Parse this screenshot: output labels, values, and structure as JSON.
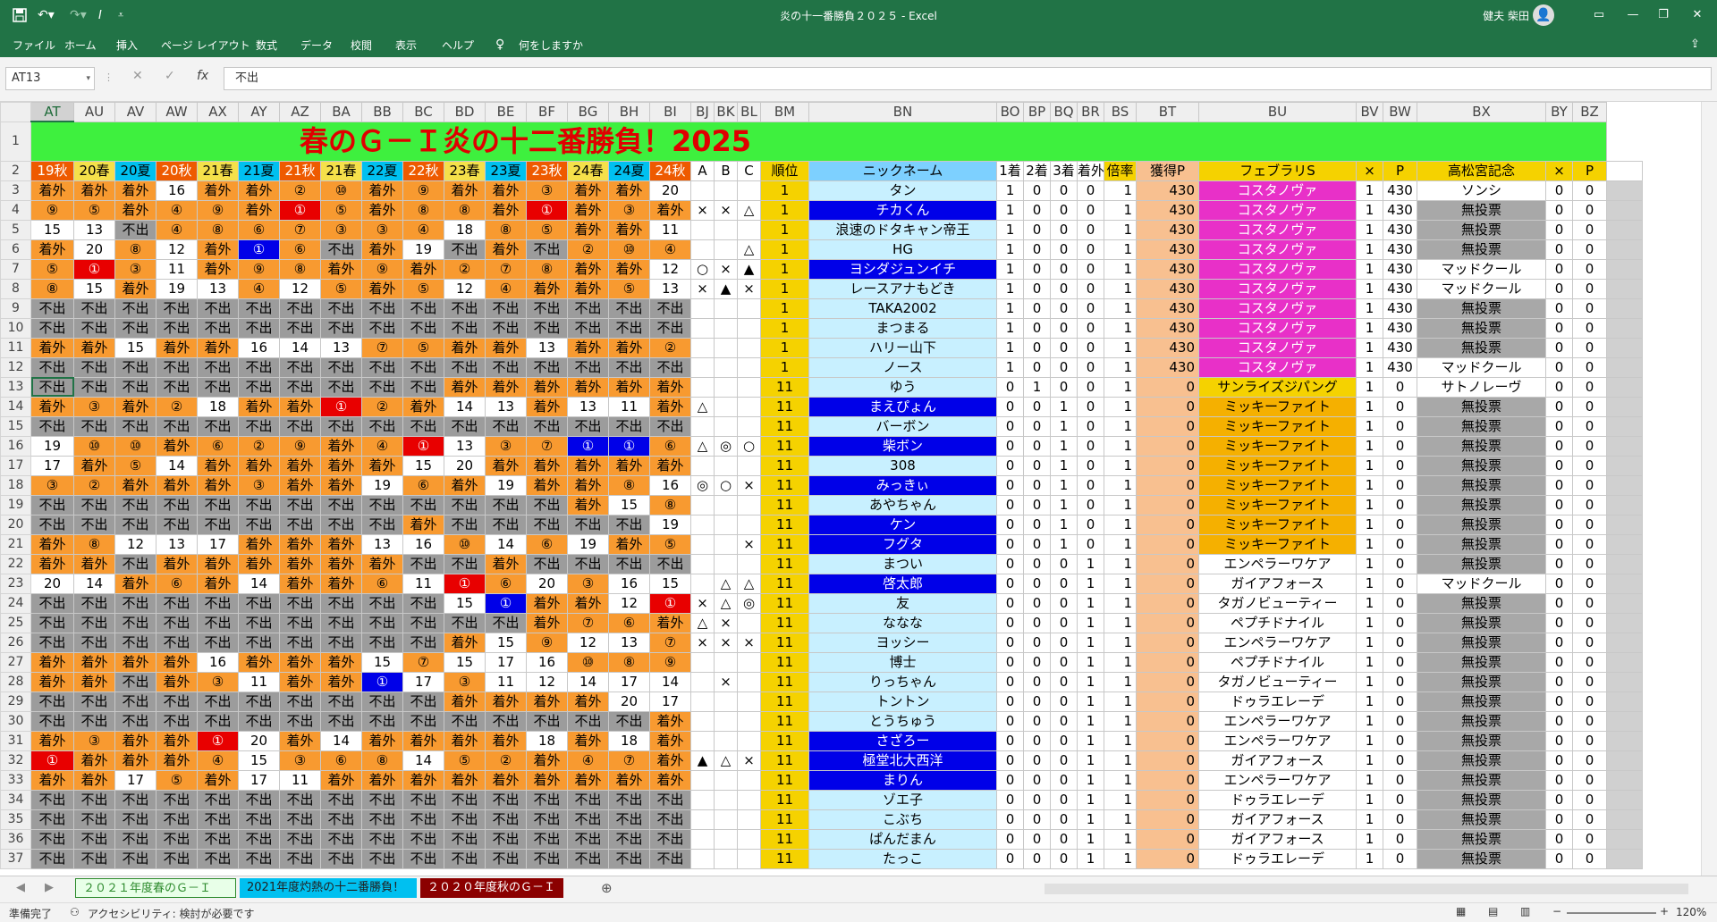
{
  "window": {
    "title": "炎の十一番勝負２０２５  -  Excel",
    "user": "健夫 柴田",
    "min": "—",
    "max": "❐",
    "close": "✕"
  },
  "menu": [
    "ファイル",
    "ホーム",
    "挿入",
    "ページ レイアウト",
    "数式",
    "データ",
    "校閲",
    "表示",
    "ヘルプ",
    "何をしますか"
  ],
  "namebox": "AT13",
  "formula": "不出",
  "columns": [
    "AT",
    "AU",
    "AV",
    "AW",
    "AX",
    "AY",
    "AZ",
    "BA",
    "BB",
    "BC",
    "BD",
    "BE",
    "BF",
    "BG",
    "BH",
    "BI",
    "BJ",
    "BK",
    "BL",
    "BM",
    "BN",
    "BO",
    "BP",
    "BQ",
    "BR",
    "BS",
    "BT",
    "BU",
    "BV",
    "BW",
    "BX",
    "BY",
    "BZ"
  ],
  "title": "春のＧ－Ｉ炎の十二番勝負！2025",
  "header": [
    "19秋",
    "20春",
    "20夏",
    "20秋",
    "21春",
    "21夏",
    "21秋",
    "21春",
    "22夏",
    "22秋",
    "23春",
    "23夏",
    "23秋",
    "24春",
    "24夏",
    "24秋",
    "A",
    "B",
    "C",
    "順位",
    "ニックネーム",
    "1着",
    "2着",
    "3着",
    "着外",
    "倍率",
    "獲得P",
    "フェブラリS",
    "×",
    "P",
    "高松宮記念",
    "×",
    "P",
    ""
  ],
  "rows": [
    {
      "n": "3",
      "c": [
        "着外",
        "着外",
        "着外",
        "16",
        "着外",
        "着外",
        "②",
        "⑩",
        "着外",
        "⑨",
        "着外",
        "着外",
        "③",
        "着外",
        "着外",
        "20",
        "",
        "",
        "",
        "1",
        "タン",
        "1",
        "0",
        "0",
        "0",
        "1",
        "430",
        "コスタノヴァ",
        "1",
        "430",
        "ソンシ",
        "0",
        "0",
        ""
      ]
    },
    {
      "n": "4",
      "c": [
        "⑨",
        "⑤",
        "着外",
        "④",
        "⑨",
        "着外",
        "①",
        "⑤",
        "着外",
        "⑧",
        "⑧",
        "着外",
        "①",
        "着外",
        "③",
        "着外",
        "×",
        "×",
        "△",
        "1",
        "チカくん",
        "1",
        "0",
        "0",
        "0",
        "1",
        "430",
        "コスタノヴァ",
        "1",
        "430",
        "無投票",
        "0",
        "0",
        ""
      ]
    },
    {
      "n": "5",
      "c": [
        "15",
        "13",
        "不出",
        "④",
        "⑧",
        "⑥",
        "⑦",
        "③",
        "③",
        "④",
        "18",
        "⑧",
        "⑤",
        "着外",
        "着外",
        "11",
        "",
        "",
        "",
        "1",
        "浪速のドタキャン帝王",
        "1",
        "0",
        "0",
        "0",
        "1",
        "430",
        "コスタノヴァ",
        "1",
        "430",
        "無投票",
        "0",
        "0",
        ""
      ]
    },
    {
      "n": "6",
      "c": [
        "着外",
        "20",
        "⑧",
        "12",
        "着外",
        "①",
        "⑥",
        "不出",
        "着外",
        "19",
        "不出",
        "着外",
        "不出",
        "②",
        "⑩",
        "④",
        "",
        "",
        "△",
        "1",
        "HG",
        "1",
        "0",
        "0",
        "0",
        "1",
        "430",
        "コスタノヴァ",
        "1",
        "430",
        "無投票",
        "0",
        "0",
        ""
      ]
    },
    {
      "n": "7",
      "c": [
        "⑤",
        "①",
        "③",
        "11",
        "着外",
        "⑨",
        "⑧",
        "着外",
        "⑨",
        "着外",
        "②",
        "⑦",
        "⑧",
        "着外",
        "着外",
        "12",
        "○",
        "×",
        "▲",
        "1",
        "ヨシダジュンイチ",
        "1",
        "0",
        "0",
        "0",
        "1",
        "430",
        "コスタノヴァ",
        "1",
        "430",
        "マッドクール",
        "0",
        "0",
        ""
      ]
    },
    {
      "n": "8",
      "c": [
        "⑧",
        "15",
        "着外",
        "19",
        "13",
        "④",
        "12",
        "⑤",
        "着外",
        "⑤",
        "12",
        "④",
        "着外",
        "着外",
        "⑤",
        "13",
        "×",
        "▲",
        "×",
        "1",
        "レースアナもどき",
        "1",
        "0",
        "0",
        "0",
        "1",
        "430",
        "コスタノヴァ",
        "1",
        "430",
        "マッドクール",
        "0",
        "0",
        ""
      ]
    },
    {
      "n": "9",
      "c": [
        "不出",
        "不出",
        "不出",
        "不出",
        "不出",
        "不出",
        "不出",
        "不出",
        "不出",
        "不出",
        "不出",
        "不出",
        "不出",
        "不出",
        "不出",
        "不出",
        "",
        "",
        "",
        "1",
        "TAKA2002",
        "1",
        "0",
        "0",
        "0",
        "1",
        "430",
        "コスタノヴァ",
        "1",
        "430",
        "無投票",
        "0",
        "0",
        ""
      ]
    },
    {
      "n": "10",
      "c": [
        "不出",
        "不出",
        "不出",
        "不出",
        "不出",
        "不出",
        "不出",
        "不出",
        "不出",
        "不出",
        "不出",
        "不出",
        "不出",
        "不出",
        "不出",
        "不出",
        "",
        "",
        "",
        "1",
        "まつまる",
        "1",
        "0",
        "0",
        "0",
        "1",
        "430",
        "コスタノヴァ",
        "1",
        "430",
        "無投票",
        "0",
        "0",
        ""
      ]
    },
    {
      "n": "11",
      "c": [
        "着外",
        "着外",
        "15",
        "着外",
        "着外",
        "16",
        "14",
        "13",
        "⑦",
        "⑤",
        "着外",
        "着外",
        "13",
        "着外",
        "着外",
        "②",
        "",
        "",
        "",
        "1",
        "ハリー山下",
        "1",
        "0",
        "0",
        "0",
        "1",
        "430",
        "コスタノヴァ",
        "1",
        "430",
        "無投票",
        "0",
        "0",
        ""
      ]
    },
    {
      "n": "12",
      "c": [
        "不出",
        "不出",
        "不出",
        "不出",
        "不出",
        "不出",
        "不出",
        "不出",
        "不出",
        "不出",
        "不出",
        "不出",
        "不出",
        "不出",
        "不出",
        "不出",
        "",
        "",
        "",
        "1",
        "ノース",
        "1",
        "0",
        "0",
        "0",
        "1",
        "430",
        "コスタノヴァ",
        "1",
        "430",
        "マッドクール",
        "0",
        "0",
        ""
      ]
    },
    {
      "n": "13",
      "c": [
        "不出",
        "不出",
        "不出",
        "不出",
        "不出",
        "不出",
        "不出",
        "不出",
        "不出",
        "不出",
        "着外",
        "着外",
        "着外",
        "着外",
        "着外",
        "着外",
        "",
        "",
        "",
        "11",
        "ゆう",
        "0",
        "1",
        "0",
        "0",
        "1",
        "0",
        "サンライズジパング",
        "1",
        "0",
        "サトノレーヴ",
        "0",
        "0",
        ""
      ]
    },
    {
      "n": "14",
      "c": [
        "着外",
        "③",
        "着外",
        "②",
        "18",
        "着外",
        "着外",
        "①",
        "②",
        "着外",
        "14",
        "13",
        "着外",
        "13",
        "11",
        "着外",
        "△",
        "",
        "",
        "11",
        "まえぴょん",
        "0",
        "0",
        "1",
        "0",
        "1",
        "0",
        "ミッキーファイト",
        "1",
        "0",
        "無投票",
        "0",
        "0",
        ""
      ]
    },
    {
      "n": "15",
      "c": [
        "不出",
        "不出",
        "不出",
        "不出",
        "不出",
        "不出",
        "不出",
        "不出",
        "不出",
        "不出",
        "不出",
        "不出",
        "不出",
        "不出",
        "不出",
        "不出",
        "",
        "",
        "",
        "11",
        "バーボン",
        "0",
        "0",
        "1",
        "0",
        "1",
        "0",
        "ミッキーファイト",
        "1",
        "0",
        "無投票",
        "0",
        "0",
        ""
      ]
    },
    {
      "n": "16",
      "c": [
        "19",
        "⑩",
        "⑩",
        "着外",
        "⑥",
        "②",
        "⑨",
        "着外",
        "④",
        "①",
        "13",
        "③",
        "⑦",
        "①",
        "①",
        "⑥",
        "△",
        "◎",
        "○",
        "11",
        "柴ボン",
        "0",
        "0",
        "1",
        "0",
        "1",
        "0",
        "ミッキーファイト",
        "1",
        "0",
        "無投票",
        "0",
        "0",
        ""
      ]
    },
    {
      "n": "17",
      "c": [
        "17",
        "着外",
        "⑤",
        "14",
        "着外",
        "着外",
        "着外",
        "着外",
        "着外",
        "15",
        "20",
        "着外",
        "着外",
        "着外",
        "着外",
        "着外",
        "",
        "",
        "",
        "11",
        "308",
        "0",
        "0",
        "1",
        "0",
        "1",
        "0",
        "ミッキーファイト",
        "1",
        "0",
        "無投票",
        "0",
        "0",
        ""
      ]
    },
    {
      "n": "18",
      "c": [
        "③",
        "②",
        "着外",
        "着外",
        "着外",
        "③",
        "着外",
        "着外",
        "19",
        "⑥",
        "着外",
        "19",
        "着外",
        "着外",
        "⑧",
        "16",
        "◎",
        "○",
        "×",
        "11",
        "みっきぃ",
        "0",
        "0",
        "1",
        "0",
        "1",
        "0",
        "ミッキーファイト",
        "1",
        "0",
        "無投票",
        "0",
        "0",
        ""
      ]
    },
    {
      "n": "19",
      "c": [
        "不出",
        "不出",
        "不出",
        "不出",
        "不出",
        "不出",
        "不出",
        "不出",
        "不出",
        "不出",
        "不出",
        "不出",
        "不出",
        "着外",
        "15",
        "⑧",
        "",
        "",
        "",
        "11",
        "あやちゃん",
        "0",
        "0",
        "1",
        "0",
        "1",
        "0",
        "ミッキーファイト",
        "1",
        "0",
        "無投票",
        "0",
        "0",
        ""
      ]
    },
    {
      "n": "20",
      "c": [
        "不出",
        "不出",
        "不出",
        "不出",
        "不出",
        "不出",
        "不出",
        "不出",
        "不出",
        "着外",
        "不出",
        "不出",
        "不出",
        "不出",
        "不出",
        "19",
        "",
        "",
        "",
        "11",
        "ケン",
        "0",
        "0",
        "1",
        "0",
        "1",
        "0",
        "ミッキーファイト",
        "1",
        "0",
        "無投票",
        "0",
        "0",
        ""
      ]
    },
    {
      "n": "21",
      "c": [
        "着外",
        "⑧",
        "12",
        "13",
        "17",
        "着外",
        "着外",
        "着外",
        "13",
        "16",
        "⑩",
        "14",
        "⑥",
        "19",
        "着外",
        "⑤",
        "",
        "",
        "×",
        "11",
        "フグタ",
        "0",
        "0",
        "1",
        "0",
        "1",
        "0",
        "ミッキーファイト",
        "1",
        "0",
        "無投票",
        "0",
        "0",
        ""
      ]
    },
    {
      "n": "22",
      "c": [
        "着外",
        "着外",
        "不出",
        "着外",
        "着外",
        "着外",
        "着外",
        "着外",
        "着外",
        "不出",
        "不出",
        "着外",
        "不出",
        "不出",
        "不出",
        "不出",
        "",
        "",
        "",
        "11",
        "まつい",
        "0",
        "0",
        "0",
        "1",
        "1",
        "0",
        "エンペラーワケア",
        "1",
        "0",
        "無投票",
        "0",
        "0",
        ""
      ]
    },
    {
      "n": "23",
      "c": [
        "20",
        "14",
        "着外",
        "⑥",
        "着外",
        "14",
        "着外",
        "着外",
        "⑥",
        "11",
        "①",
        "⑥",
        "20",
        "③",
        "16",
        "15",
        "",
        "△",
        "△",
        "11",
        "啓太郎",
        "0",
        "0",
        "0",
        "1",
        "1",
        "0",
        "ガイアフォース",
        "1",
        "0",
        "マッドクール",
        "0",
        "0",
        ""
      ]
    },
    {
      "n": "24",
      "c": [
        "不出",
        "不出",
        "不出",
        "不出",
        "不出",
        "不出",
        "不出",
        "不出",
        "不出",
        "不出",
        "15",
        "①",
        "着外",
        "着外",
        "12",
        "①",
        "×",
        "△",
        "◎",
        "11",
        "友",
        "0",
        "0",
        "0",
        "1",
        "1",
        "0",
        "タガノビューティー",
        "1",
        "0",
        "無投票",
        "0",
        "0",
        ""
      ]
    },
    {
      "n": "25",
      "c": [
        "不出",
        "不出",
        "不出",
        "不出",
        "不出",
        "不出",
        "不出",
        "不出",
        "不出",
        "不出",
        "不出",
        "不出",
        "着外",
        "⑦",
        "⑥",
        "着外",
        "△",
        "×",
        "",
        "11",
        "ななな",
        "0",
        "0",
        "0",
        "1",
        "1",
        "0",
        "ペプチドナイル",
        "1",
        "0",
        "無投票",
        "0",
        "0",
        ""
      ]
    },
    {
      "n": "26",
      "c": [
        "不出",
        "不出",
        "不出",
        "不出",
        "不出",
        "不出",
        "不出",
        "不出",
        "不出",
        "不出",
        "着外",
        "15",
        "⑨",
        "12",
        "13",
        "⑦",
        "×",
        "×",
        "×",
        "11",
        "ヨッシー",
        "0",
        "0",
        "0",
        "1",
        "1",
        "0",
        "エンペラーワケア",
        "1",
        "0",
        "無投票",
        "0",
        "0",
        ""
      ]
    },
    {
      "n": "27",
      "c": [
        "着外",
        "着外",
        "着外",
        "着外",
        "16",
        "着外",
        "着外",
        "着外",
        "15",
        "⑦",
        "15",
        "17",
        "16",
        "⑩",
        "⑧",
        "⑨",
        "",
        "",
        "",
        "11",
        "博士",
        "0",
        "0",
        "0",
        "1",
        "1",
        "0",
        "ペプチドナイル",
        "1",
        "0",
        "無投票",
        "0",
        "0",
        ""
      ]
    },
    {
      "n": "28",
      "c": [
        "着外",
        "着外",
        "不出",
        "着外",
        "③",
        "11",
        "着外",
        "着外",
        "①",
        "17",
        "③",
        "11",
        "12",
        "14",
        "17",
        "14",
        "",
        "×",
        "",
        "11",
        "りっちゃん",
        "0",
        "0",
        "0",
        "1",
        "1",
        "0",
        "タガノビューティー",
        "1",
        "0",
        "無投票",
        "0",
        "0",
        ""
      ]
    },
    {
      "n": "29",
      "c": [
        "不出",
        "不出",
        "不出",
        "不出",
        "不出",
        "不出",
        "不出",
        "不出",
        "不出",
        "不出",
        "着外",
        "着外",
        "着外",
        "着外",
        "20",
        "17",
        "",
        "",
        "",
        "11",
        "トントン",
        "0",
        "0",
        "0",
        "1",
        "1",
        "0",
        "ドゥラエレーデ",
        "1",
        "0",
        "無投票",
        "0",
        "0",
        ""
      ]
    },
    {
      "n": "30",
      "c": [
        "不出",
        "不出",
        "不出",
        "不出",
        "不出",
        "不出",
        "不出",
        "不出",
        "不出",
        "不出",
        "不出",
        "不出",
        "不出",
        "不出",
        "不出",
        "着外",
        "",
        "",
        "",
        "11",
        "とうちゅう",
        "0",
        "0",
        "0",
        "1",
        "1",
        "0",
        "エンペラーワケア",
        "1",
        "0",
        "無投票",
        "0",
        "0",
        ""
      ]
    },
    {
      "n": "31",
      "c": [
        "着外",
        "③",
        "着外",
        "着外",
        "①",
        "20",
        "着外",
        "14",
        "着外",
        "着外",
        "着外",
        "着外",
        "18",
        "着外",
        "18",
        "着外",
        "",
        "",
        "",
        "11",
        "さざろー",
        "0",
        "0",
        "0",
        "1",
        "1",
        "0",
        "エンペラーワケア",
        "1",
        "0",
        "無投票",
        "0",
        "0",
        ""
      ]
    },
    {
      "n": "32",
      "c": [
        "①",
        "着外",
        "着外",
        "着外",
        "④",
        "15",
        "③",
        "⑥",
        "⑧",
        "14",
        "⑤",
        "②",
        "着外",
        "④",
        "⑦",
        "着外",
        "▲",
        "△",
        "×",
        "11",
        "極堂北大西洋",
        "0",
        "0",
        "0",
        "1",
        "1",
        "0",
        "ガイアフォース",
        "1",
        "0",
        "無投票",
        "0",
        "0",
        ""
      ]
    },
    {
      "n": "33",
      "c": [
        "着外",
        "着外",
        "17",
        "⑤",
        "着外",
        "17",
        "11",
        "着外",
        "着外",
        "着外",
        "着外",
        "着外",
        "着外",
        "着外",
        "着外",
        "着外",
        "",
        "",
        "",
        "11",
        "まりん",
        "0",
        "0",
        "0",
        "1",
        "1",
        "0",
        "エンペラーワケア",
        "1",
        "0",
        "無投票",
        "0",
        "0",
        ""
      ]
    },
    {
      "n": "34",
      "c": [
        "不出",
        "不出",
        "不出",
        "不出",
        "不出",
        "不出",
        "不出",
        "不出",
        "不出",
        "不出",
        "不出",
        "不出",
        "不出",
        "不出",
        "不出",
        "不出",
        "",
        "",
        "",
        "11",
        "ゾエ子",
        "0",
        "0",
        "0",
        "1",
        "1",
        "0",
        "ドゥラエレーデ",
        "1",
        "0",
        "無投票",
        "0",
        "0",
        ""
      ]
    },
    {
      "n": "35",
      "c": [
        "不出",
        "不出",
        "不出",
        "不出",
        "不出",
        "不出",
        "不出",
        "不出",
        "不出",
        "不出",
        "不出",
        "不出",
        "不出",
        "不出",
        "不出",
        "不出",
        "",
        "",
        "",
        "11",
        "こぶち",
        "0",
        "0",
        "0",
        "1",
        "1",
        "0",
        "ガイアフォース",
        "1",
        "0",
        "無投票",
        "0",
        "0",
        ""
      ]
    },
    {
      "n": "36",
      "c": [
        "不出",
        "不出",
        "不出",
        "不出",
        "不出",
        "不出",
        "不出",
        "不出",
        "不出",
        "不出",
        "不出",
        "不出",
        "不出",
        "不出",
        "不出",
        "不出",
        "",
        "",
        "",
        "11",
        "ぱんだまん",
        "0",
        "0",
        "0",
        "1",
        "1",
        "0",
        "ガイアフォース",
        "1",
        "0",
        "無投票",
        "0",
        "0",
        ""
      ]
    },
    {
      "n": "37",
      "c": [
        "不出",
        "不出",
        "不出",
        "不出",
        "不出",
        "不出",
        "不出",
        "不出",
        "不出",
        "不出",
        "不出",
        "不出",
        "不出",
        "不出",
        "不出",
        "不出",
        "",
        "",
        "",
        "11",
        "たっこ",
        "0",
        "0",
        "0",
        "1",
        "1",
        "0",
        "ドゥラエレーデ",
        "1",
        "0",
        "無投票",
        "0",
        "0",
        ""
      ]
    }
  ],
  "tabs": [
    "２０２１年度春のＧ－Ｉ",
    "2021年度灼熱の十二番勝負！",
    "２０２０年度秋のＧ－Ｉ"
  ],
  "status": {
    "ready": "準備完了",
    "accessibility": "アクセシビリティ: 検討が必要です",
    "zoom": "120%"
  }
}
